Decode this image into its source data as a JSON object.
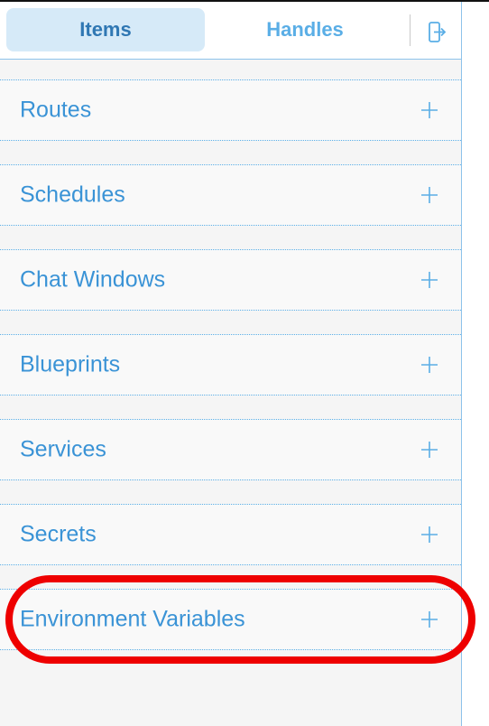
{
  "tabs": {
    "items_label": "Items",
    "handles_label": "Handles",
    "active": "Items"
  },
  "header": {
    "exit_icon": "sign-out-icon"
  },
  "list": {
    "add_icon": "plus-icon",
    "items": [
      {
        "label": "Routes"
      },
      {
        "label": "Schedules"
      },
      {
        "label": "Chat Windows"
      },
      {
        "label": "Blueprints"
      },
      {
        "label": "Services"
      },
      {
        "label": "Secrets"
      },
      {
        "label": "Environment Variables"
      }
    ]
  },
  "colors": {
    "accent": "#3a93d6",
    "active_tab_bg": "#d6eaf8",
    "highlight": "#ee0000",
    "panel_bg": "#f5f5f5"
  }
}
